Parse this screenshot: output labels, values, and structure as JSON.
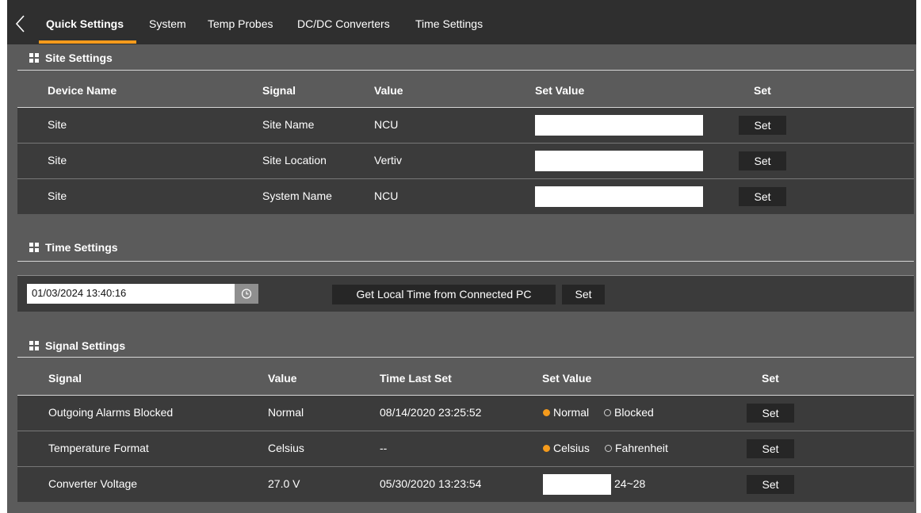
{
  "tabs": [
    {
      "label": "Quick Settings",
      "active": true
    },
    {
      "label": "System",
      "active": false
    },
    {
      "label": "Temp Probes",
      "active": false
    },
    {
      "label": "DC/DC Converters",
      "active": false
    },
    {
      "label": "Time Settings",
      "active": false
    }
  ],
  "colors": {
    "accent": "#f59b1c",
    "background": "#5b5b5b",
    "topbar": "#2f2f2f",
    "row": "#3b3b3b",
    "button": "#262626"
  },
  "site_settings": {
    "title": "Site Settings",
    "columns": [
      "Device Name",
      "Signal",
      "Value",
      "Set Value",
      "Set"
    ],
    "rows": [
      {
        "device": "Site",
        "signal": "Site Name",
        "value": "NCU",
        "set_value": "",
        "set_label": "Set"
      },
      {
        "device": "Site",
        "signal": "Site Location",
        "value": "Vertiv",
        "set_value": "",
        "set_label": "Set"
      },
      {
        "device": "Site",
        "signal": "System Name",
        "value": "NCU",
        "set_value": "",
        "set_label": "Set"
      }
    ]
  },
  "time_settings": {
    "title": "Time Settings",
    "datetime_value": "01/03/2024 13:40:16",
    "get_local_time_label": "Get Local Time from Connected PC",
    "set_label": "Set"
  },
  "signal_settings": {
    "title": "Signal Settings",
    "columns": [
      "Signal",
      "Value",
      "Time Last Set",
      "Set Value",
      "Set"
    ],
    "rows": [
      {
        "signal": "Outgoing Alarms Blocked",
        "value": "Normal",
        "time_last_set": "08/14/2020 23:25:52",
        "options": [
          {
            "label": "Normal",
            "selected": true
          },
          {
            "label": "Blocked",
            "selected": false
          }
        ],
        "set_label": "Set"
      },
      {
        "signal": "Temperature Format",
        "value": "Celsius",
        "time_last_set": "--",
        "options": [
          {
            "label": "Celsius",
            "selected": true
          },
          {
            "label": "Fahrenheit",
            "selected": false
          }
        ],
        "set_label": "Set"
      },
      {
        "signal": "Converter Voltage",
        "value": "27.0 V",
        "time_last_set": "05/30/2020 13:23:54",
        "input_value": "",
        "range": "24~28",
        "set_label": "Set"
      }
    ]
  }
}
